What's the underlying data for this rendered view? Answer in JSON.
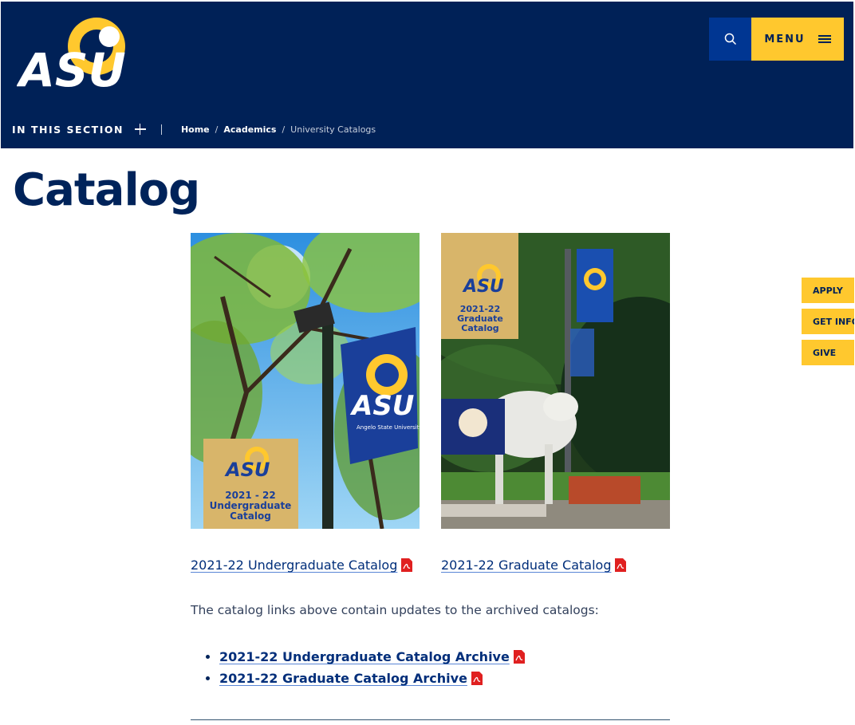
{
  "header": {
    "logo_text": "ASU",
    "menu_label": "MENU",
    "section_label": "IN THIS SECTION",
    "breadcrumb": [
      {
        "label": "Home"
      },
      {
        "label": "Academics"
      }
    ],
    "breadcrumb_current": "University Catalogs"
  },
  "page": {
    "title": "Catalog"
  },
  "covers": {
    "undergraduate": {
      "banner_text": "ASU",
      "banner_small": "Angelo State University",
      "label_line1": "2021 - 22",
      "label_line2": "Undergraduate",
      "label_line3": "Catalog"
    },
    "graduate": {
      "label_line1": "2021-22",
      "label_line2": "Graduate",
      "label_line3": "Catalog"
    }
  },
  "catalog_links": {
    "undergraduate": "2021-22 Undergraduate Catalog",
    "graduate": "2021-22 Graduate Catalog"
  },
  "intro_text": "The catalog links above contain updates to the archived catalogs:",
  "archive_links": [
    {
      "label": "2021-22 Undergraduate Catalog Archive"
    },
    {
      "label": "2021-22 Graduate Catalog Archive"
    }
  ],
  "side_tabs": [
    {
      "label": "APPLY"
    },
    {
      "label": "GET INFO"
    },
    {
      "label": "GIVE"
    }
  ],
  "colors": {
    "navy": "#002157",
    "gold": "#ffc82e",
    "royal": "#003692",
    "pdf_red": "#e02020"
  },
  "icons": [
    "search-icon",
    "hamburger-icon",
    "plus-icon",
    "pdf-icon"
  ]
}
